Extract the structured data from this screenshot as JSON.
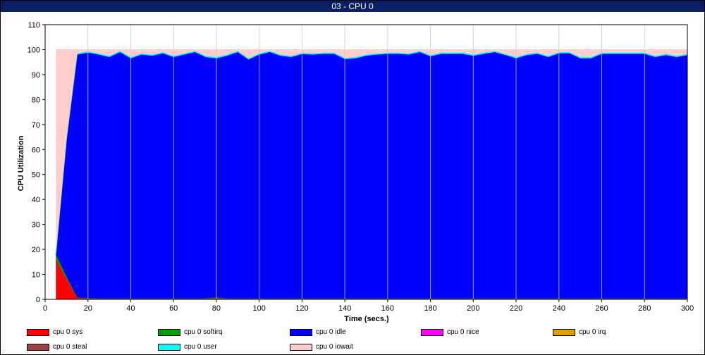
{
  "window": {
    "title": "03 - CPU 0"
  },
  "chart_data": {
    "type": "area",
    "stacked": true,
    "xlabel": "Time (secs.)",
    "ylabel": "CPU Utilization",
    "xlim": [
      0,
      300
    ],
    "ylim": [
      0,
      110
    ],
    "x_ticks": [
      0,
      20,
      40,
      60,
      80,
      100,
      120,
      140,
      160,
      180,
      200,
      220,
      240,
      260,
      280,
      300
    ],
    "y_ticks": [
      0,
      10,
      20,
      30,
      40,
      50,
      60,
      70,
      80,
      90,
      100,
      110
    ],
    "grid": true,
    "legend_position": "bottom",
    "x": [
      5,
      10,
      15,
      20,
      25,
      30,
      35,
      40,
      45,
      50,
      55,
      60,
      65,
      70,
      75,
      80,
      85,
      90,
      95,
      100,
      105,
      110,
      115,
      120,
      125,
      130,
      135,
      140,
      145,
      150,
      155,
      160,
      165,
      170,
      175,
      180,
      185,
      190,
      195,
      200,
      205,
      210,
      215,
      220,
      225,
      230,
      235,
      240,
      245,
      250,
      255,
      260,
      265,
      270,
      275,
      280,
      285,
      290,
      295,
      300
    ],
    "series": [
      {
        "name": "cpu 0 sys",
        "color": "#ff0000",
        "values": [
          16,
          8,
          0.5,
          0.3,
          0.2,
          0.2,
          0.2,
          0.2,
          0.2,
          0.2,
          0.2,
          0.2,
          0.2,
          0.2,
          0.2,
          0.4,
          0.2,
          0.2,
          0.2,
          0.2,
          0.2,
          0.2,
          0.2,
          0.2,
          0.2,
          0.2,
          0.2,
          0.2,
          0.2,
          0.2,
          0.2,
          0.2,
          0.2,
          0.2,
          0.2,
          0.2,
          0.2,
          0.2,
          0.2,
          0.2,
          0.2,
          0.2,
          0.2,
          0.2,
          0.2,
          0.2,
          0.2,
          0.2,
          0.2,
          0.2,
          0.2,
          0.2,
          0.2,
          0.2,
          0.2,
          0.2,
          0.2,
          0.2,
          0.2,
          0.2
        ]
      },
      {
        "name": "cpu 0 softirq",
        "color": "#00a000",
        "values": [
          2,
          1,
          0.3,
          0.2,
          0.2,
          0.2,
          0.2,
          0.2,
          0.2,
          0.2,
          0.2,
          0.2,
          0.2,
          0.2,
          0.2,
          0.4,
          0.2,
          0.2,
          0.2,
          0.2,
          0.2,
          0.2,
          0.2,
          0.2,
          0.2,
          0.2,
          0.2,
          0.2,
          0.2,
          0.2,
          0.2,
          0.2,
          0.2,
          0.2,
          0.2,
          0.2,
          0.2,
          0.2,
          0.2,
          0.2,
          0.2,
          0.2,
          0.2,
          0.2,
          0.2,
          0.2,
          0.2,
          0.2,
          0.2,
          0.2,
          0.2,
          0.2,
          0.2,
          0.2,
          0.2,
          0.2,
          0.2,
          0.2,
          0.2,
          0.2
        ]
      },
      {
        "name": "cpu 0 idle",
        "color": "#0000ff",
        "values": [
          0,
          55,
          97.2,
          98.3,
          97.6,
          96.6,
          98.6,
          96.1,
          97.6,
          97.1,
          98.1,
          96.6,
          97.6,
          98.6,
          96.6,
          95.7,
          97.1,
          98.6,
          95.6,
          97.6,
          98.6,
          97.1,
          96.6,
          97.8,
          97.6,
          97.9,
          97.9,
          95.8,
          96.1,
          97.1,
          97.6,
          97.9,
          97.9,
          97.6,
          98.6,
          96.9,
          97.9,
          97.9,
          97.9,
          97.1,
          97.9,
          98.6,
          97.4,
          96.1,
          97.4,
          97.9,
          96.6,
          98.1,
          98.1,
          96.1,
          96.1,
          97.9,
          97.9,
          97.9,
          97.9,
          97.9,
          96.6,
          97.4,
          96.6,
          97.4
        ]
      },
      {
        "name": "cpu 0 nice",
        "color": "#ff00ff",
        "values": []
      },
      {
        "name": "cpu 0 irq",
        "color": "#e0a000",
        "values": []
      },
      {
        "name": "cpu 0 steal",
        "color": "#a04040",
        "values": []
      },
      {
        "name": "cpu 0 user",
        "color": "#00ffff",
        "values": [
          0,
          0.5,
          0.5,
          0.5,
          0.5,
          0.5,
          0.5,
          0.5,
          0.5,
          0.5,
          0.5,
          0.5,
          0.5,
          0.5,
          0.5,
          0.5,
          0.5,
          0.5,
          0.5,
          0.5,
          0.5,
          0.5,
          0.5,
          0.5,
          0.5,
          0.5,
          0.5,
          0.5,
          0.5,
          0.5,
          0.5,
          0.5,
          0.5,
          0.5,
          0.5,
          0.5,
          0.5,
          0.5,
          0.5,
          0.5,
          0.5,
          0.5,
          0.5,
          0.5,
          0.5,
          0.5,
          0.5,
          0.5,
          0.5,
          0.5,
          0.5,
          0.5,
          0.5,
          0.5,
          0.5,
          0.5,
          0.5,
          0.5,
          0.5,
          0.5
        ]
      },
      {
        "name": "cpu 0 iowait",
        "color": "#ffcccc",
        "fill_to": 100,
        "values": []
      }
    ]
  }
}
